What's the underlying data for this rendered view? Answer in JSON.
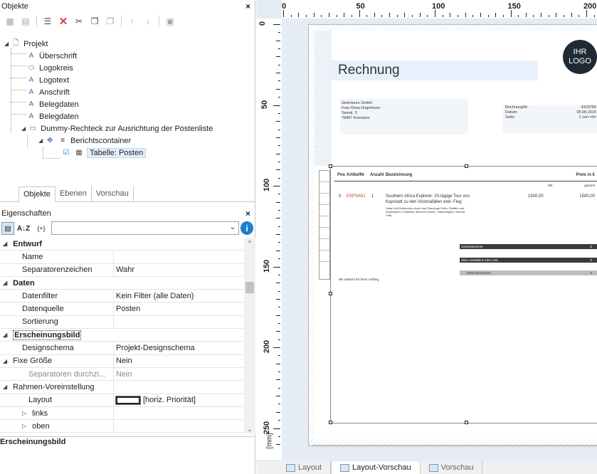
{
  "objects_panel": {
    "title": "Objekte",
    "close": "×",
    "tree": [
      {
        "label": "Projekt",
        "icon": "page-icon",
        "level": 0
      },
      {
        "label": "Überschrift",
        "icon": "text-A-icon",
        "level": 1
      },
      {
        "label": "Logokreis",
        "icon": "ellipse-icon",
        "level": 1
      },
      {
        "label": "Logotext",
        "icon": "text-A-icon",
        "level": 1
      },
      {
        "label": "Anschrift",
        "icon": "text-A-icon",
        "level": 1
      },
      {
        "label": "Belegdaten",
        "icon": "text-A-icon",
        "level": 1
      },
      {
        "label": "Belegdaten",
        "icon": "text-A-icon",
        "level": 1
      },
      {
        "label": "Dummy-Rechteck zur Ausrichtung der Postenliste",
        "icon": "rectangle-icon",
        "level": 1
      },
      {
        "label": "Berichtscontainer",
        "icon": "container-icon",
        "level": 2
      },
      {
        "label": "Tabelle: Posten",
        "icon": "table-icon",
        "level": 3
      }
    ],
    "tabs": [
      "Objekte",
      "Ebenen",
      "Vorschau"
    ],
    "active_tab": "Objekte"
  },
  "properties_panel": {
    "title": "Eigenschaften",
    "close": "×",
    "sort_label": "A↓Z",
    "formula_label": "{+}",
    "info": "i",
    "rows": [
      {
        "type": "cat",
        "key": "Entwurf"
      },
      {
        "type": "prop",
        "key": "Name",
        "value": ""
      },
      {
        "type": "prop",
        "key": "Separatorenzeichen",
        "value": "Wahr"
      },
      {
        "type": "cat",
        "key": "Daten"
      },
      {
        "type": "prop",
        "key": "Datenfilter",
        "value": "Kein Filter (alle Daten)"
      },
      {
        "type": "prop",
        "key": "Datenquelle",
        "value": "Posten"
      },
      {
        "type": "prop",
        "key": "Sortierung",
        "value": ""
      },
      {
        "type": "cat",
        "key": "Erscheinungsbild"
      },
      {
        "type": "prop",
        "key": "Designschema",
        "value": "Projekt-Designschema"
      },
      {
        "type": "subcat",
        "key": "Fixe Größe",
        "value": "Nein"
      },
      {
        "type": "prop2",
        "key": "Separatoren durchzi...",
        "value": "Nein"
      },
      {
        "type": "subcat",
        "key": "Rahmen-Voreinstellung",
        "value": ""
      },
      {
        "type": "prop2",
        "key": "Layout",
        "value": "[horiz. Priorität]"
      },
      {
        "type": "subexp",
        "key": "links",
        "value": ""
      },
      {
        "type": "subexp",
        "key": "oben",
        "value": ""
      }
    ],
    "description_title": "Erscheinungsbild"
  },
  "ruler": {
    "h_labels": [
      "0",
      "50",
      "100",
      "150",
      "200"
    ],
    "v_labels": [
      "0",
      "50",
      "100",
      "150",
      "200",
      "250"
    ],
    "unit": "[mm]"
  },
  "document": {
    "heading": "Rechnung",
    "logo_line1": "IHR",
    "logo_line2": "LOGO",
    "address": [
      "Gelertours GmbH",
      "Frau Rosa Ungeheuer",
      "Seestr. 3",
      "78467 Konstanz"
    ],
    "meta_labels": [
      "RechnungNr:",
      "Datum:",
      "Seite:"
    ],
    "meta_values": [
      "4323780",
      "05.08.2015",
      "1 von =0="
    ],
    "table_headers": [
      "Pos",
      "ArtikelNr",
      "Anzahl",
      "Bezeichnung",
      "Preis in €"
    ],
    "price_sub": [
      "Stk.",
      "gesamt"
    ],
    "item_pos": "0",
    "item_nr": "EXPSA01",
    "item_qty": "1",
    "item_desc1": "Southern Africa Explorer: 20-tägige Tour von",
    "item_desc2": "Kapstadt zu den Victoriafällen exkl. Flug",
    "item_note1": "Safari mit Einbäumen durch das Okavango Delta, Kletttern auf",
    "item_note2": "Sanddünen in Namibia, Besuch Etosha - Nationalpark, Victoria",
    "item_note3": "Falls.",
    "item_price": "1500,00",
    "item_total": "1500,00",
    "sum_labels": [
      "Gesamtsumme",
      "darin enthaltene 19% USt.",
      "Zwischensumme"
    ],
    "sum_values": [
      "0",
      "0",
      "0"
    ],
    "thanks": "Wir danken für Ihren Aufbeg."
  },
  "bottom_tabs": [
    "Layout",
    "Layout-Vorschau",
    "Vorschau"
  ],
  "active_bottom_tab": "Layout-Vorschau",
  "colors": {
    "accent": "#1b7fd0",
    "logo": "#1f2a35",
    "heading_band": "#e8f1fb",
    "sum_bar": "#3a3a3a",
    "item_red": "#c0392b"
  }
}
